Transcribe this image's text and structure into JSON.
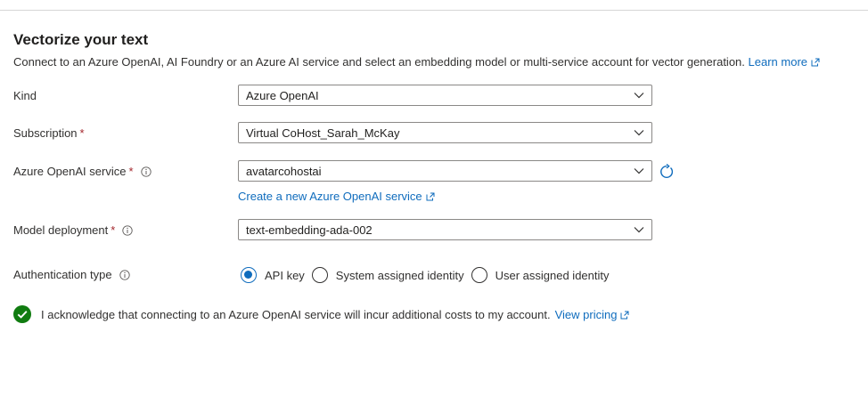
{
  "section": {
    "title": "Vectorize your text",
    "description": "Connect to an Azure OpenAI, AI Foundry or an Azure AI service and select an embedding model or multi-service account for vector generation.",
    "learn_more": "Learn more"
  },
  "fields": {
    "kind": {
      "label": "Kind",
      "value": "Azure OpenAI"
    },
    "subscription": {
      "label": "Subscription",
      "required": "*",
      "value": "Virtual CoHost_Sarah_McKay"
    },
    "openai_service": {
      "label": "Azure OpenAI service",
      "required": "*",
      "value": "avatarcohostai",
      "create_link": "Create a new Azure OpenAI service"
    },
    "model_deployment": {
      "label": "Model deployment",
      "required": "*",
      "value": "text-embedding-ada-002"
    },
    "auth_type": {
      "label": "Authentication type",
      "options": [
        "API key",
        "System assigned identity",
        "User assigned identity"
      ],
      "selected": "API key"
    }
  },
  "acknowledgement": {
    "text": "I acknowledge that connecting to an Azure OpenAI service will incur additional costs to my account.",
    "link": "View pricing"
  },
  "colors": {
    "accent": "#0f6cbd",
    "required": "#a4262c",
    "success": "#107c10"
  }
}
